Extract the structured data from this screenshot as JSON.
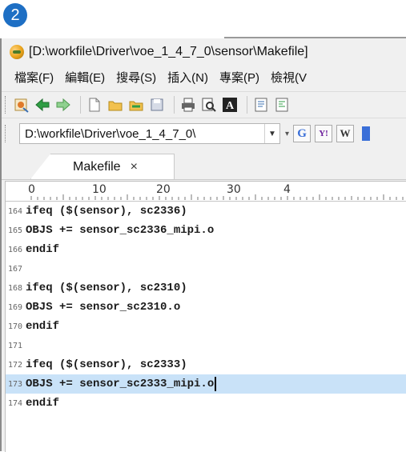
{
  "step_badge": "2",
  "window": {
    "title": "[D:\\workfile\\Driver\\voe_1_4_7_0\\sensor\\Makefile]"
  },
  "menu": [
    "檔案(F)",
    "編輯(E)",
    "搜尋(S)",
    "插入(N)",
    "專案(P)",
    "檢視(V"
  ],
  "toolbar_icons": [
    "app-settings-icon",
    "back-arrow-icon",
    "forward-arrow-icon",
    "new-file-icon",
    "open-folder-icon",
    "open-project-icon",
    "save-icon",
    "print-icon",
    "print-preview-icon",
    "font-icon",
    "document-icon",
    "document-lines-icon"
  ],
  "pathbar": {
    "path": "D:\\workfile\\Driver\\voe_1_4_7_0\\",
    "search_buttons": [
      "G",
      "Y!",
      "W"
    ]
  },
  "tab": {
    "label": "Makefile",
    "close": "×"
  },
  "ruler": {
    "start": "0",
    "marks": [
      "10",
      "20",
      "30",
      "4"
    ]
  },
  "code_lines": [
    {
      "num": "164",
      "text": "ifeq ($(sensor), sc2336)"
    },
    {
      "num": "165",
      "text": "OBJS += sensor_sc2336_mipi.o"
    },
    {
      "num": "166",
      "text": "endif"
    },
    {
      "num": "167",
      "text": ""
    },
    {
      "num": "168",
      "text": "ifeq ($(sensor), sc2310)"
    },
    {
      "num": "169",
      "text": "OBJS += sensor_sc2310.o"
    },
    {
      "num": "170",
      "text": "endif"
    },
    {
      "num": "171",
      "text": ""
    },
    {
      "num": "172",
      "text": "ifeq ($(sensor), sc2333)"
    },
    {
      "num": "173",
      "text": "OBJS += sensor_sc2333_mipi.o"
    },
    {
      "num": "174",
      "text": "endif"
    }
  ],
  "selected_line": "173",
  "colors": {
    "badge": "#1e6fc4",
    "selection": "#c9e2f8"
  }
}
